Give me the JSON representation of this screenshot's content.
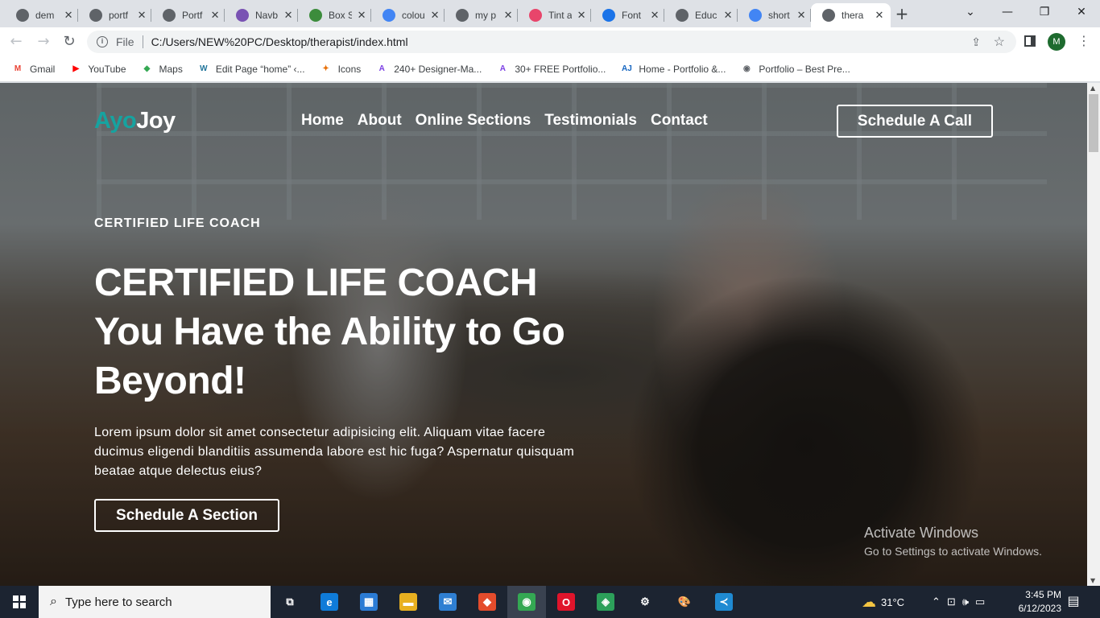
{
  "browser": {
    "tabs": [
      {
        "title": "dem",
        "favicon": "globe-icon",
        "color": "#5f6368"
      },
      {
        "title": "portf",
        "favicon": "globe-icon",
        "color": "#5f6368"
      },
      {
        "title": "Portf",
        "favicon": "globe-icon",
        "color": "#5f6368"
      },
      {
        "title": "Navb",
        "favicon": "bootstrap-icon",
        "color": "#7952b3"
      },
      {
        "title": "Box S",
        "favicon": "square-icon",
        "color": "#3c8c3c"
      },
      {
        "title": "colou",
        "favicon": "google-icon",
        "color": "#4285f4"
      },
      {
        "title": "my p",
        "favicon": "globe-icon",
        "color": "#5f6368"
      },
      {
        "title": "Tint a",
        "favicon": "gradient-icon",
        "color": "#e8456b"
      },
      {
        "title": "Font",
        "favicon": "flag-icon",
        "color": "#1a73e8"
      },
      {
        "title": "Educ",
        "favicon": "globe-icon",
        "color": "#5f6368"
      },
      {
        "title": "short",
        "favicon": "google-icon",
        "color": "#4285f4"
      },
      {
        "title": "thera",
        "favicon": "globe-icon",
        "color": "#5f6368",
        "active": true
      }
    ],
    "new_tab": "+",
    "controls": {
      "down": "⌄",
      "minimize": "—",
      "restore": "❐",
      "close": "✕"
    },
    "address": {
      "info": "i",
      "scheme": "File",
      "url": "C:/Users/NEW%20PC/Desktop/therapist/index.html"
    },
    "profile_initial": "M",
    "bookmarks": [
      {
        "label": "Gmail",
        "icon": "gmail-icon",
        "color": "#ea4335",
        "glyph": "M"
      },
      {
        "label": "YouTube",
        "icon": "youtube-icon",
        "color": "#ff0000",
        "glyph": "▶"
      },
      {
        "label": "Maps",
        "icon": "maps-icon",
        "color": "#34a853",
        "glyph": "◆"
      },
      {
        "label": "Edit Page “home” ‹...",
        "icon": "wordpress-icon",
        "color": "#21759b",
        "glyph": "W"
      },
      {
        "label": "Icons",
        "icon": "icons-icon",
        "color": "#e8710a",
        "glyph": "✦"
      },
      {
        "label": "240+ Designer-Ma...",
        "icon": "creative-icon",
        "color": "#7b3fe4",
        "glyph": "A"
      },
      {
        "label": "30+ FREE Portfolio...",
        "icon": "creative-icon",
        "color": "#7b3fe4",
        "glyph": "A"
      },
      {
        "label": "Home - Portfolio &...",
        "icon": "aj-icon",
        "color": "#1565c0",
        "glyph": "AJ"
      },
      {
        "label": "Portfolio – Best Pre...",
        "icon": "globe-icon",
        "color": "#5f6368",
        "glyph": "◉"
      }
    ]
  },
  "site": {
    "brand_a": "Ayo",
    "brand_b": "Joy",
    "brand_accent": "#16a3a0",
    "nav": [
      "Home",
      "About",
      "Online Sections",
      "Testimonials",
      "Contact"
    ],
    "cta_call": "Schedule A Call",
    "eyebrow": "CERTIFIED LIFE COACH",
    "headline_1": "CERTIFIED LIFE COACH",
    "headline_2": "You Have the Ability to Go",
    "headline_3": "Beyond!",
    "lede": "Lorem ipsum dolor sit amet consectetur adipisicing elit. Aliquam vitae facere ducimus eligendi blanditiis assumenda labore est hic fuga? Aspernatur quisquam beatae atque delectus eius?",
    "cta_section": "Schedule A Section"
  },
  "os": {
    "activation_title": "Activate Windows",
    "activation_sub": "Go to Settings to activate Windows.",
    "search_placeholder": "Type here to search",
    "taskbar_apps": [
      {
        "name": "task-view-icon",
        "glyph": "⧉",
        "color": "transparent"
      },
      {
        "name": "edge-icon",
        "glyph": "e",
        "color": "#0f7bd8"
      },
      {
        "name": "store-icon",
        "glyph": "▦",
        "color": "#2b7bd4"
      },
      {
        "name": "file-explorer-icon",
        "glyph": "▬",
        "color": "#e8b020"
      },
      {
        "name": "mail-icon",
        "glyph": "✉",
        "color": "#2f7fd2"
      },
      {
        "name": "git-icon",
        "glyph": "◆",
        "color": "#e44c2c"
      },
      {
        "name": "chrome-icon",
        "glyph": "◉",
        "color": "#34a853",
        "active": true
      },
      {
        "name": "opera-icon",
        "glyph": "O",
        "color": "#e0142b"
      },
      {
        "name": "xd-icon",
        "glyph": "◈",
        "color": "#2ca05a"
      },
      {
        "name": "settings-icon",
        "glyph": "⚙",
        "color": "transparent"
      },
      {
        "name": "paint-icon",
        "glyph": "🎨",
        "color": "transparent"
      },
      {
        "name": "vscode-icon",
        "glyph": "≺",
        "color": "#1f8ad2"
      }
    ],
    "weather_temp": "31°C",
    "time": "3:45 PM",
    "date": "6/12/2023",
    "notifications": "1"
  }
}
